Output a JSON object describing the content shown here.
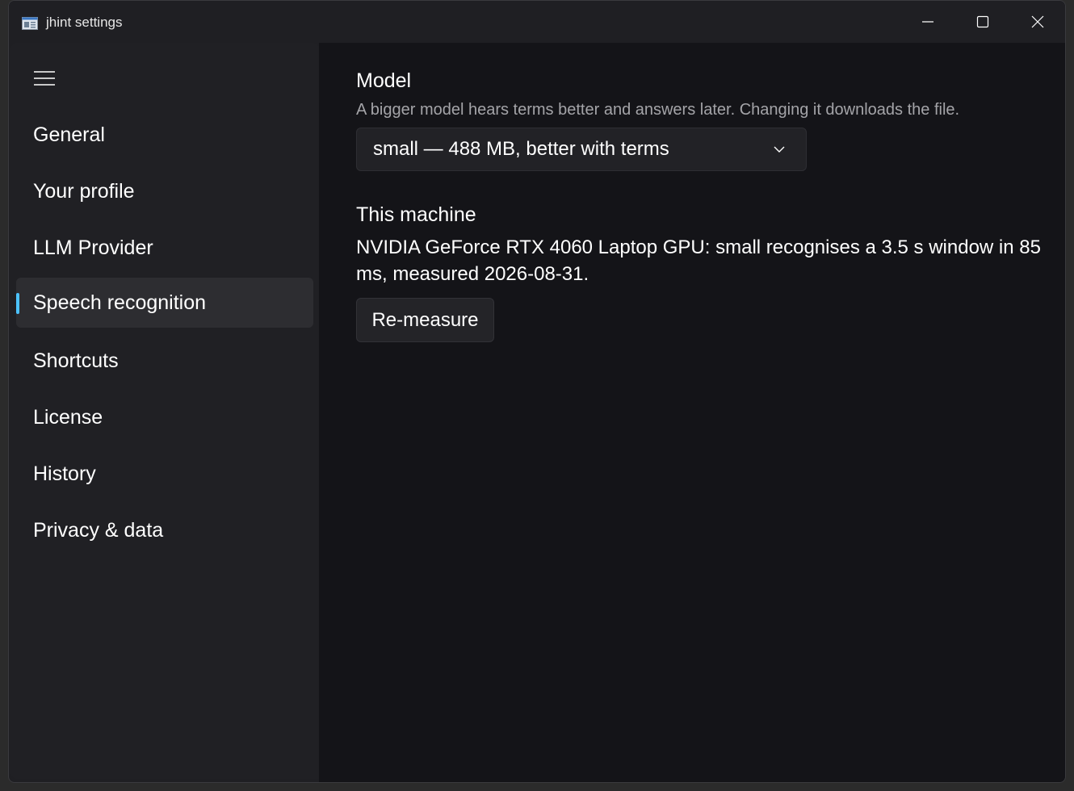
{
  "window": {
    "title": "jhint settings",
    "app_icon": "settings-window-icon",
    "controls": {
      "minimize_icon": "minimize-icon",
      "maximize_icon": "maximize-icon",
      "close_icon": "close-icon"
    }
  },
  "sidebar": {
    "menu_icon": "hamburger-menu-icon",
    "items": [
      {
        "label": "General",
        "active": false
      },
      {
        "label": "Your profile",
        "active": false
      },
      {
        "label": "LLM Provider",
        "active": false
      },
      {
        "label": "Speech recognition",
        "active": true
      },
      {
        "label": "Shortcuts",
        "active": false
      },
      {
        "label": "License",
        "active": false
      },
      {
        "label": "History",
        "active": false
      },
      {
        "label": "Privacy & data",
        "active": false
      }
    ]
  },
  "main": {
    "model": {
      "title": "Model",
      "description": "A bigger model hears terms better and answers later. Changing it downloads the file.",
      "selected_value": "small — 488 MB, better with terms",
      "dropdown_icon": "chevron-down-icon"
    },
    "machine": {
      "title": "This machine",
      "text": "NVIDIA GeForce RTX 4060 Laptop GPU: small recognises a 3.5 s window in 85 ms, measured 2026-08-31.",
      "button_label": "Re-measure"
    }
  },
  "colors": {
    "accent": "#4cc2ff",
    "background": "#141418",
    "sidebar": "#202024"
  }
}
